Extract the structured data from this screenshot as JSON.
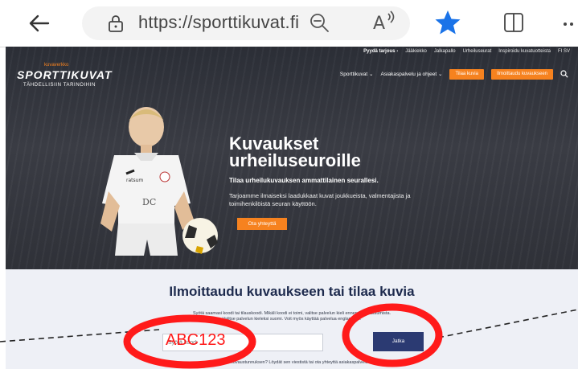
{
  "browser": {
    "url": "https://sporttikuvat.fi",
    "icons": [
      "back-arrow-icon",
      "lock-icon",
      "zoom-out-icon",
      "read-aloud-icon",
      "favorite-star-icon",
      "split-screen-icon",
      "more-icon"
    ],
    "accent_color": "#1a73e8"
  },
  "site": {
    "top_links": [
      {
        "label": "Pyydä tarjous",
        "arrow": "›"
      },
      {
        "label": "Jääkiekko"
      },
      {
        "label": "Jalkapallo"
      },
      {
        "label": "Urheiluseurat"
      },
      {
        "label": "Inspiroidu kuvatuotteista"
      },
      {
        "label": "FI SV"
      }
    ],
    "logo": {
      "tagline": "kuvaverkko",
      "name": "SPORTTIKUVAT",
      "subtitle": "TÄHDELLISIIN TARINOIHIN"
    },
    "nav": {
      "items": [
        "Sporttikuvat ⌄",
        "Asiakaspalvelu ja ohjeet ⌄"
      ],
      "order_button": "Tilaa kuvia",
      "signup_button": "Ilmoittaudu kuvaukseen"
    },
    "hero": {
      "title": "Kuvaukset urheiluseuroille",
      "subtitle": "Tilaa urheilukuvauksen ammattilainen seurallesi.",
      "description": "Tarjoamme ilmaiseksi laadukkaat kuvat joukkueista, valmentajista ja toimihenkilöistä seuran käyttöön.",
      "cta": "Ota yhteyttä"
    },
    "signup": {
      "title": "Ilmoittaudu kuvaukseen tai tilaa kuvia",
      "info_line1": "Syötä saamasi koodi tai tilauskoodi. Mikäli koodi ei toimi, valitse palvelun kieli ennen ilmoittautumista.",
      "info_line2": "Valitse palvelun kieleksi suomi. Voit myös käyttää palvelua englanniksi.",
      "input_placeholder": "Syötä koodi",
      "input_value": "",
      "submit": "Jatka",
      "footer": "Unohditko kuvaustunnuksen? Löydät sen viestistä tai ota yhteyttä asiakaspalveluun."
    }
  },
  "annotation": {
    "typed_text": "ABC123",
    "color": "#ff1a1a"
  }
}
